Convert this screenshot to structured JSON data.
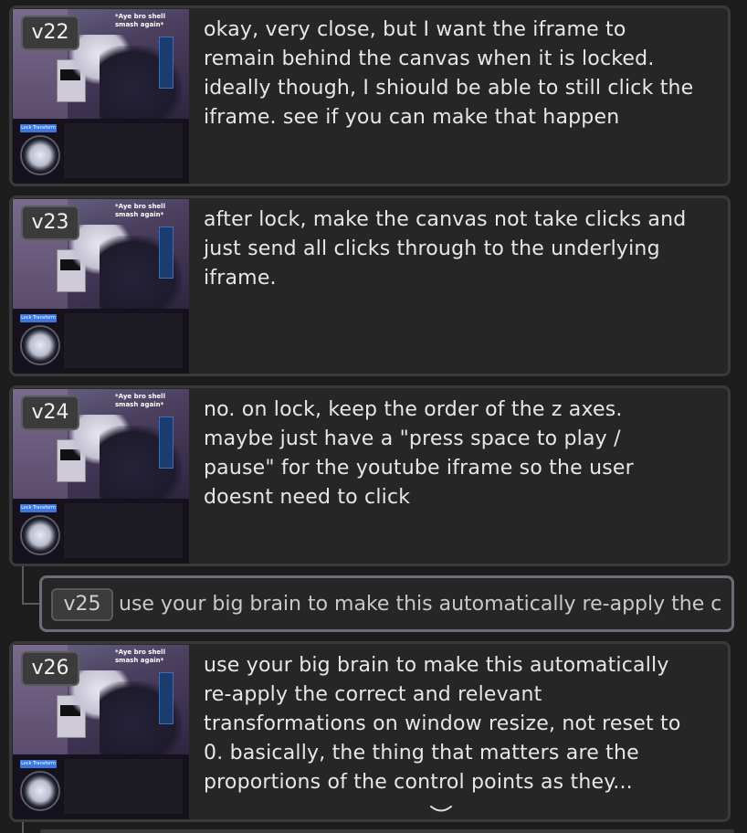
{
  "entries": [
    {
      "version": "v22",
      "message": "okay, very close, but I want the iframe to remain behind the canvas when it is locked. ideally though, I shiould be able to still click the iframe. see if you can make that happen",
      "thumb_caption": "*Aye bro shell smash again*",
      "thumb_lock": "Lock Transform"
    },
    {
      "version": "v23",
      "message": "after lock, make the canvas not take clicks and just send all clicks through to the underlying iframe.",
      "thumb_caption": "*Aye bro shell smash again*",
      "thumb_lock": "Lock Transform"
    },
    {
      "version": "v24",
      "message": "no. on lock, keep the order of the z axes. maybe just have a \"press space to play / pause\" for the youtube iframe so the user doesnt need to click",
      "thumb_caption": "*Aye bro shell smash again*",
      "thumb_lock": "Lock Transform"
    },
    {
      "version": "v26",
      "message": "use your big brain to make this automatically re-apply the correct and relevant transformations on window resize, not reset to 0. basically, the thing that matters are the proportions of the control points as they...",
      "thumb_caption": "*Aye bro shell smash again*",
      "thumb_lock": "Lock Transform"
    }
  ],
  "collapsed": {
    "version": "v25",
    "message": "use your big brain to make this automatically re-apply the c"
  },
  "icons": {
    "expand": "chevron-down-icon"
  },
  "colors": {
    "background": "#1d1d1d",
    "card": "#262626",
    "selected_border": "#6a6f77"
  }
}
